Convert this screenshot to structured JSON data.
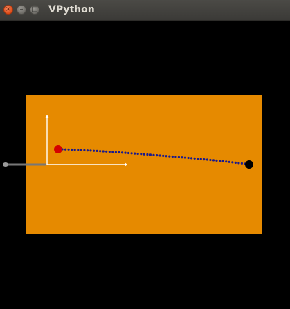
{
  "window": {
    "title": "VPython",
    "controls": {
      "close_glyph": "×",
      "minimize_glyph": "–",
      "maximize_glyph": "□"
    }
  },
  "scene": {
    "background_color": "#000000",
    "box_color": "#e68a00",
    "axes_color": "#ffffff",
    "trail_color": "#1a1a8c",
    "start_ball_color": "#d40000",
    "end_ball_color": "#000000",
    "projectile_marker_color": "#666666"
  }
}
